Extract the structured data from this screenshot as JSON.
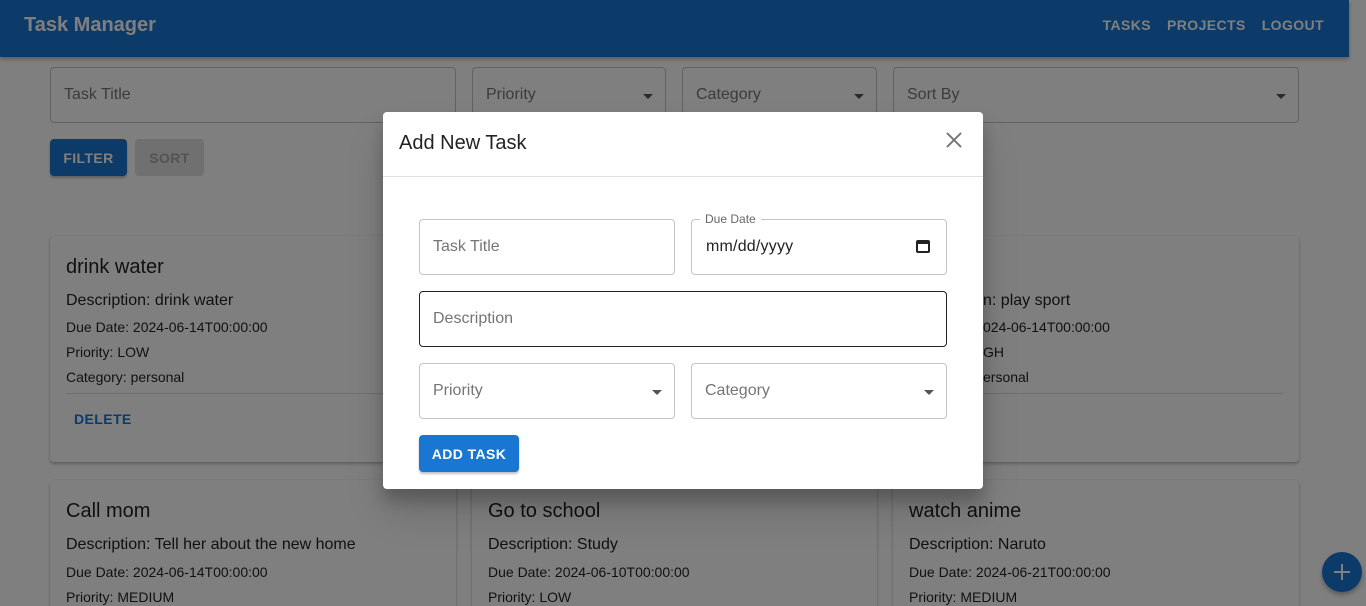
{
  "app": {
    "title": "Task Manager"
  },
  "nav": [
    "TASKS",
    "PROJECTS",
    "LOGOUT"
  ],
  "filters": {
    "task_title_placeholder": "Task Title",
    "priority_placeholder": "Priority",
    "category_placeholder": "Category",
    "sort_placeholder": "Sort By",
    "filter_button": "FILTER",
    "sort_button": "SORT"
  },
  "cards": [
    {
      "title": "drink water",
      "description": "Description: drink water",
      "due": "Due Date: 2024-06-14T00:00:00",
      "priority": "Priority: LOW",
      "category": "Category: personal",
      "delete": "DELETE"
    },
    {
      "description": "n: play sport",
      "due": "024-06-14T00:00:00",
      "priority": "GH",
      "category": "ersonal"
    },
    {
      "title": "Call mom",
      "description": "Description: Tell her about the new home",
      "due": "Due Date: 2024-06-14T00:00:00",
      "priority": "Priority: MEDIUM"
    },
    {
      "title": "Go to school",
      "description": "Description: Study",
      "due": "Due Date: 2024-06-10T00:00:00",
      "priority": "Priority: LOW"
    },
    {
      "title": "watch anime",
      "description": "Description: Naruto",
      "due": "Due Date: 2024-06-21T00:00:00",
      "priority": "Priority: MEDIUM"
    }
  ],
  "dialog": {
    "title": "Add New Task",
    "task_title_placeholder": "Task Title",
    "due_date_label": "Due Date",
    "due_date_value": "mm/dd/yyyy",
    "description_placeholder": "Description",
    "priority_placeholder": "Priority",
    "category_placeholder": "Category",
    "add_button": "ADD TASK"
  },
  "icons": [
    "close-icon",
    "calendar-icon",
    "dropdown-arrow-icon",
    "add-icon"
  ],
  "colors": {
    "primary": "#1976d2",
    "backdrop": "rgba(0,0,0,0.5)"
  }
}
